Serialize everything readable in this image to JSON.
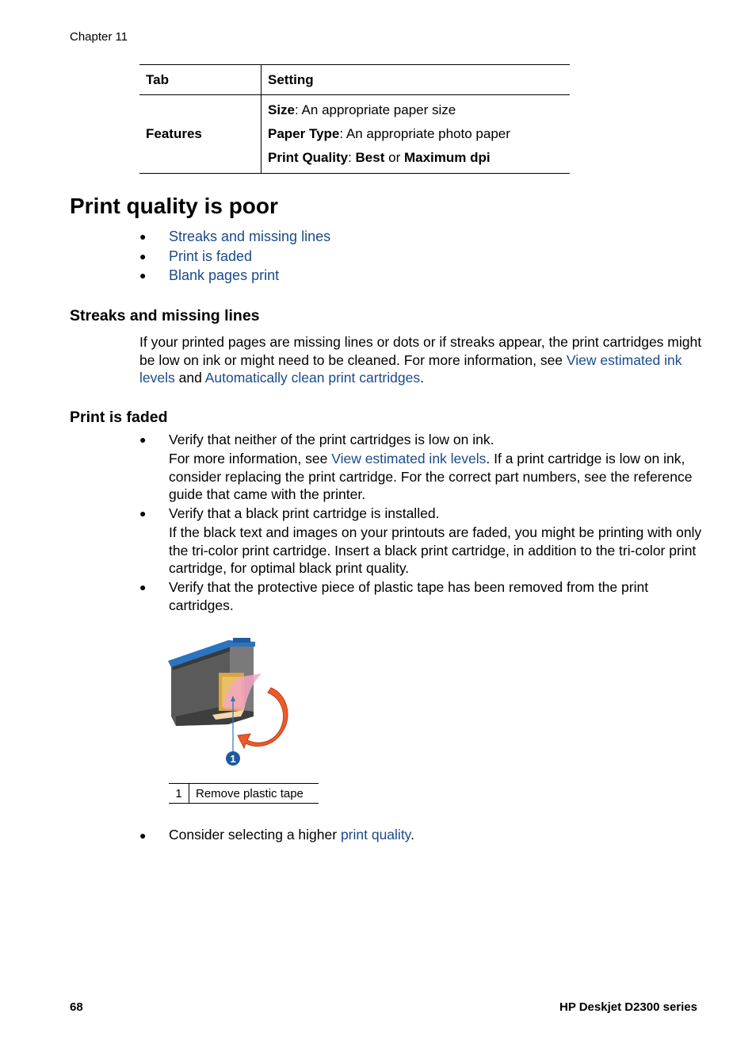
{
  "header": {
    "chapter": "Chapter 11"
  },
  "settings_table": {
    "headers": [
      "Tab",
      "Setting"
    ],
    "rows": [
      {
        "tab": "Features",
        "settings": [
          {
            "label": "Size",
            "sep": ": ",
            "value": "An appropriate paper size"
          },
          {
            "label": "Paper Type",
            "sep": ": ",
            "value": "An appropriate photo paper"
          },
          {
            "label": "Print Quality",
            "sep": ": ",
            "value_parts": [
              "Best",
              " or ",
              "Maximum dpi"
            ]
          }
        ]
      }
    ]
  },
  "section": {
    "title": "Print quality is poor",
    "toc": [
      "Streaks and missing lines",
      "Print is faded",
      "Blank pages print"
    ]
  },
  "streaks": {
    "heading": "Streaks and missing lines",
    "text_before": "If your printed pages are missing lines or dots or if streaks appear, the print cartridges might be low on ink or might need to be cleaned. For more information, see ",
    "link1": "View estimated ink levels",
    "text_mid": " and ",
    "link2": "Automatically clean print cartridges",
    "text_end": "."
  },
  "faded": {
    "heading": "Print is faded",
    "items": [
      {
        "text": "Verify that neither of the print cartridges is low on ink.",
        "detail_before": "For more information, see ",
        "detail_link": "View estimated ink levels",
        "detail_after": ". If a print cartridge is low on ink, consider replacing the print cartridge. For the correct part numbers, see the reference guide that came with the printer."
      },
      {
        "text": "Verify that a black print cartridge is installed.",
        "detail": "If the black text and images on your printouts are faded, you might be printing with only the tri-color print cartridge. Insert a black print cartridge, in addition to the tri-color print cartridge, for optimal black print quality."
      },
      {
        "text": "Verify that the protective piece of plastic tape has been removed from the print cartridges."
      }
    ],
    "figure": {
      "callout_number": "1",
      "caption_number": "1",
      "caption_text": "Remove plastic tape"
    },
    "last_item": {
      "text_before": "Consider selecting a higher ",
      "link": "print quality",
      "text_after": "."
    }
  },
  "footer": {
    "page_number": "68",
    "product": "HP Deskjet D2300 series"
  },
  "colors": {
    "link": "#1a4a8a"
  }
}
